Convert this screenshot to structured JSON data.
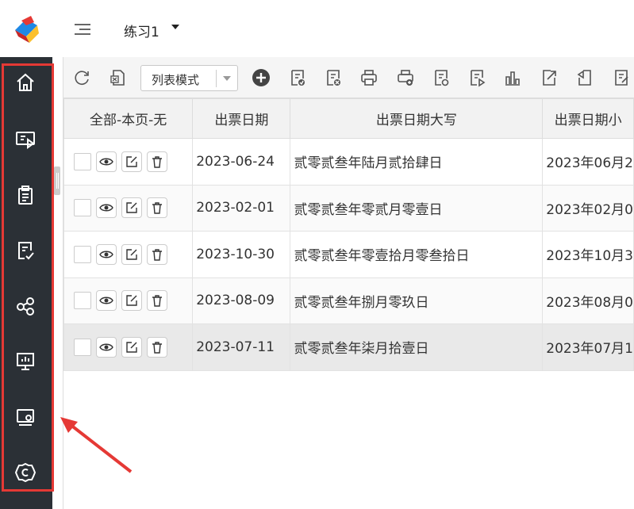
{
  "app": {
    "title": "练习1"
  },
  "toolbar": {
    "mode_label": "列表模式"
  },
  "table": {
    "headers": [
      "全部-本页-无",
      "出票日期",
      "出票日期大写",
      "出票日期小"
    ],
    "rows": [
      {
        "date": "2023-06-24",
        "upper": "贰零贰叁年陆月贰拾肆日",
        "small": "2023年06月2"
      },
      {
        "date": "2023-02-01",
        "upper": "贰零贰叁年零贰月零壹日",
        "small": "2023年02月0"
      },
      {
        "date": "2023-10-30",
        "upper": "贰零贰叁年零壹拾月零叁拾日",
        "small": "2023年10月3"
      },
      {
        "date": "2023-08-09",
        "upper": "贰零贰叁年捌月零玖日",
        "small": "2023年08月0"
      },
      {
        "date": "2023-07-11",
        "upper": "贰零贰叁年柒月拾壹日",
        "small": "2023年07月1"
      }
    ]
  },
  "sidebar": {
    "items": [
      "home-icon",
      "screen-play-icon",
      "clipboard-icon",
      "document-check-icon",
      "share-icon",
      "presentation-icon",
      "monitor-settings-icon",
      "settings-icon"
    ]
  },
  "colors": {
    "sidebar_bg": "#2b3036",
    "highlight": "#e53935"
  }
}
